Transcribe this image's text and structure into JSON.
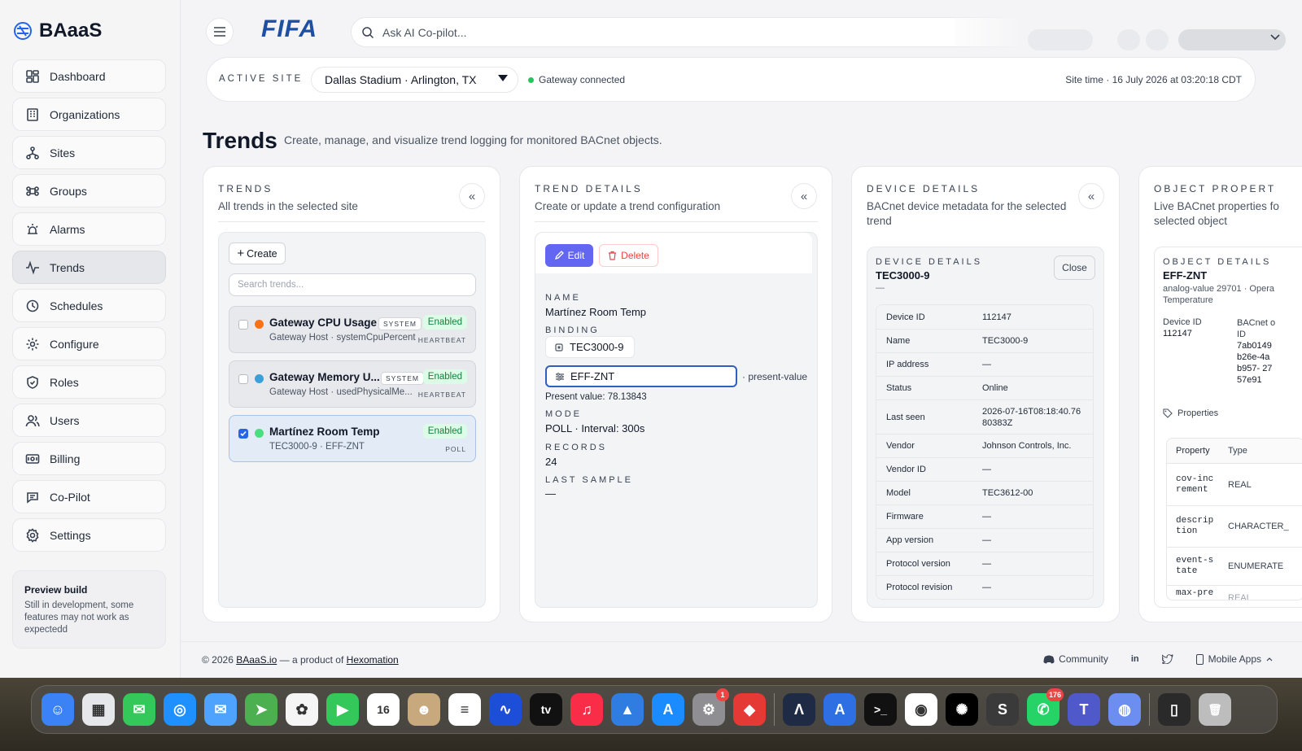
{
  "brand": {
    "name": "BAaaS"
  },
  "sidebar": {
    "items": [
      {
        "label": "Dashboard",
        "icon": "dashboard-icon"
      },
      {
        "label": "Organizations",
        "icon": "building-icon"
      },
      {
        "label": "Sites",
        "icon": "sites-icon"
      },
      {
        "label": "Groups",
        "icon": "command-icon"
      },
      {
        "label": "Alarms",
        "icon": "alarm-icon"
      },
      {
        "label": "Trends",
        "icon": "activity-icon",
        "active": true
      },
      {
        "label": "Schedules",
        "icon": "clock-icon"
      },
      {
        "label": "Configure",
        "icon": "gear-icon"
      },
      {
        "label": "Roles",
        "icon": "shield-icon"
      },
      {
        "label": "Users",
        "icon": "users-icon"
      },
      {
        "label": "Billing",
        "icon": "billing-icon"
      },
      {
        "label": "Co-Pilot",
        "icon": "copilot-icon"
      },
      {
        "label": "Settings",
        "icon": "settings-icon"
      }
    ],
    "preview": {
      "title": "Preview build",
      "desc": "Still in development, some features may not work as expectedd"
    }
  },
  "topbar": {
    "logo": "FIFA",
    "search_placeholder": "Ask AI Co-pilot..."
  },
  "sitebar": {
    "label": "ACTIVE SITE",
    "site": "Dallas Stadium · Arlington, TX",
    "gateway": "Gateway connected",
    "site_time": "Site time · 16 July 2026 at 03:20:18 CDT"
  },
  "page": {
    "title": "Trends",
    "desc": "Create, manage, and visualize trend logging for monitored BACnet objects."
  },
  "trends_panel": {
    "heading": "TRENDS",
    "sub": "All trends in the selected site",
    "create_label": "Create",
    "search_placeholder": "Search trends...",
    "items": [
      {
        "name": "Gateway CPU Usage",
        "system": "SYSTEM",
        "sub": "Gateway Host · systemCpuPercent",
        "status": "Enabled",
        "kind": "HEARTBEAT",
        "color": "#f97316"
      },
      {
        "name": "Gateway Memory U...",
        "system": "SYSTEM",
        "sub": "Gateway Host · usedPhysicalMe...",
        "status": "Enabled",
        "kind": "HEARTBEAT",
        "color": "#3b9fd8"
      },
      {
        "name": "Martínez Room Temp",
        "system": "",
        "sub": "TEC3000-9 · EFF-ZNT",
        "status": "Enabled",
        "kind": "POLL",
        "color": "#4ade80",
        "selected": true
      }
    ]
  },
  "trend_details": {
    "heading": "TREND DETAILS",
    "sub": "Create or update a trend configuration",
    "edit_label": "Edit",
    "delete_label": "Delete",
    "name_label": "NAME",
    "name": "Martínez Room Temp",
    "binding_label": "BINDING",
    "device": "TEC3000-9",
    "object": "EFF-ZNT",
    "property": "· present-value",
    "present_value": "Present value: 78.13843",
    "mode_label": "MODE",
    "mode": "POLL · Interval: 300s",
    "records_label": "RECORDS",
    "records": "24",
    "last_sample_label": "LAST SAMPLE",
    "last_sample": "—"
  },
  "device_panel": {
    "heading": "DEVICE DETAILS",
    "sub": "BACnet device metadata for the selected trend",
    "card_heading": "DEVICE DETAILS",
    "card_name": "TEC3000-9",
    "card_dash": "—",
    "close_label": "Close",
    "rows": [
      {
        "k": "Device ID",
        "v": "112147"
      },
      {
        "k": "Name",
        "v": "TEC3000-9"
      },
      {
        "k": "IP address",
        "v": "—"
      },
      {
        "k": "Status",
        "v": "Online"
      },
      {
        "k": "Last seen",
        "v": "2026-07-16T08:18:40.7680383Z"
      },
      {
        "k": "Vendor",
        "v": "Johnson Controls, Inc."
      },
      {
        "k": "Vendor ID",
        "v": "—"
      },
      {
        "k": "Model",
        "v": "TEC3612-00"
      },
      {
        "k": "Firmware",
        "v": "—"
      },
      {
        "k": "App version",
        "v": "—"
      },
      {
        "k": "Protocol version",
        "v": "—"
      },
      {
        "k": "Protocol revision",
        "v": "—"
      }
    ]
  },
  "object_panel": {
    "heading": "OBJECT PROPERT",
    "sub": "Live BACnet properties fo selected object",
    "card_heading": "OBJECT DETAILS",
    "card_name": "EFF-ZNT",
    "card_desc": "analog-value 29701 · Opera Temperature",
    "device_id_label": "Device ID",
    "device_id": "112147",
    "bacnet_label": "BACnet o ID",
    "bacnet_id": "7ab0149 b26e-4a b957- 2757e91",
    "properties_label": "Properties",
    "table_headers": [
      "Property",
      "Type"
    ],
    "rows": [
      {
        "p": "cov-inc rement",
        "t": "REAL"
      },
      {
        "p": "descrip tion",
        "t": "CHARACTER_"
      },
      {
        "p": "event-s tate",
        "t": "ENUMERATE"
      },
      {
        "p": "max-pre",
        "t": "REAL"
      }
    ]
  },
  "footer": {
    "copy_prefix": "© 2026",
    "brand_link": "BAaaS.io",
    "middle": "— a product of",
    "company_link": "Hexomation",
    "community": "Community",
    "mobile": "Mobile Apps"
  },
  "dock": {
    "apps": [
      {
        "name": "finder-icon",
        "color": "#3b82f6",
        "glyph": "☺"
      },
      {
        "name": "launchpad-icon",
        "color": "#e5e7eb",
        "glyph": "▦"
      },
      {
        "name": "messages-icon",
        "color": "#34c759",
        "glyph": "✉"
      },
      {
        "name": "safari-icon",
        "color": "#1e90ff",
        "glyph": "◎"
      },
      {
        "name": "mail-icon",
        "color": "#4da3ff",
        "glyph": "✉"
      },
      {
        "name": "maps-icon",
        "color": "#4caf50",
        "glyph": "➤"
      },
      {
        "name": "photos-icon",
        "color": "#f5f5f5",
        "glyph": "✿"
      },
      {
        "name": "facetime-icon",
        "color": "#34c759",
        "glyph": "▶"
      },
      {
        "name": "calendar-icon",
        "color": "#ffffff",
        "glyph": "16"
      },
      {
        "name": "contacts-icon",
        "color": "#c8a97e",
        "glyph": "☻"
      },
      {
        "name": "reminders-icon",
        "color": "#ffffff",
        "glyph": "≡"
      },
      {
        "name": "freeform-icon",
        "color": "#1d4ed8",
        "glyph": "∿"
      },
      {
        "name": "tv-icon",
        "color": "#111111",
        "glyph": "tv"
      },
      {
        "name": "music-icon",
        "color": "#fa2d48",
        "glyph": "♫"
      },
      {
        "name": "keynote-icon",
        "color": "#2f7de1",
        "glyph": "▲"
      },
      {
        "name": "app-store-icon",
        "color": "#1a8cff",
        "glyph": "A"
      },
      {
        "name": "system-settings-icon",
        "color": "#8e8e93",
        "glyph": "⚙",
        "badge": "1"
      },
      {
        "name": "scrobbles-icon",
        "color": "#e53935",
        "glyph": "◆"
      },
      {
        "name": "sep",
        "color": "",
        "glyph": ""
      },
      {
        "name": "arc-icon",
        "color": "#1f2a44",
        "glyph": "Λ"
      },
      {
        "name": "xcode-icon",
        "color": "#2f6fe4",
        "glyph": "A"
      },
      {
        "name": "terminal-icon",
        "color": "#111111",
        "glyph": ">_"
      },
      {
        "name": "chrome-icon",
        "color": "#ffffff",
        "glyph": "◉"
      },
      {
        "name": "chatgpt-icon",
        "color": "#000000",
        "glyph": "✺"
      },
      {
        "name": "sublime-icon",
        "color": "#3a3a3a",
        "glyph": "S"
      },
      {
        "name": "whatsapp-icon",
        "color": "#25d366",
        "glyph": "✆",
        "badge": "176"
      },
      {
        "name": "teams-icon",
        "color": "#5059c9",
        "glyph": "T"
      },
      {
        "name": "proxyman-icon",
        "color": "#6b8ef0",
        "glyph": "◍"
      },
      {
        "name": "sep",
        "color": "",
        "glyph": ""
      },
      {
        "name": "documents-icon",
        "color": "#2a2a2a",
        "glyph": "▯"
      },
      {
        "name": "trash-icon",
        "color": "#bdbdbd",
        "glyph": "🗑"
      }
    ]
  }
}
